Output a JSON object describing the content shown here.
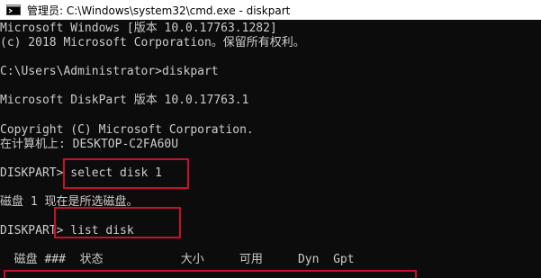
{
  "window": {
    "title": "管理员: C:\\Windows\\system32\\cmd.exe - diskpart",
    "icon": "console-icon"
  },
  "console": {
    "lines": [
      "Microsoft Windows [版本 10.0.17763.1282]",
      "(c) 2018 Microsoft Corporation。保留所有权利。",
      "C:\\Users\\Administrator>diskpart",
      "Microsoft DiskPart 版本 10.0.17763.1",
      "Copyright (C) Microsoft Corporation.",
      "在计算机上: DESKTOP-C2FA60U",
      "DISKPART> select disk 1",
      "磁盘 1 现在是所选磁盘。",
      "DISKPART> list disk",
      "  磁盘 ###  状态           大小     可用     Dyn  Gpt"
    ]
  },
  "highlights": {
    "color": "#c8102e"
  }
}
